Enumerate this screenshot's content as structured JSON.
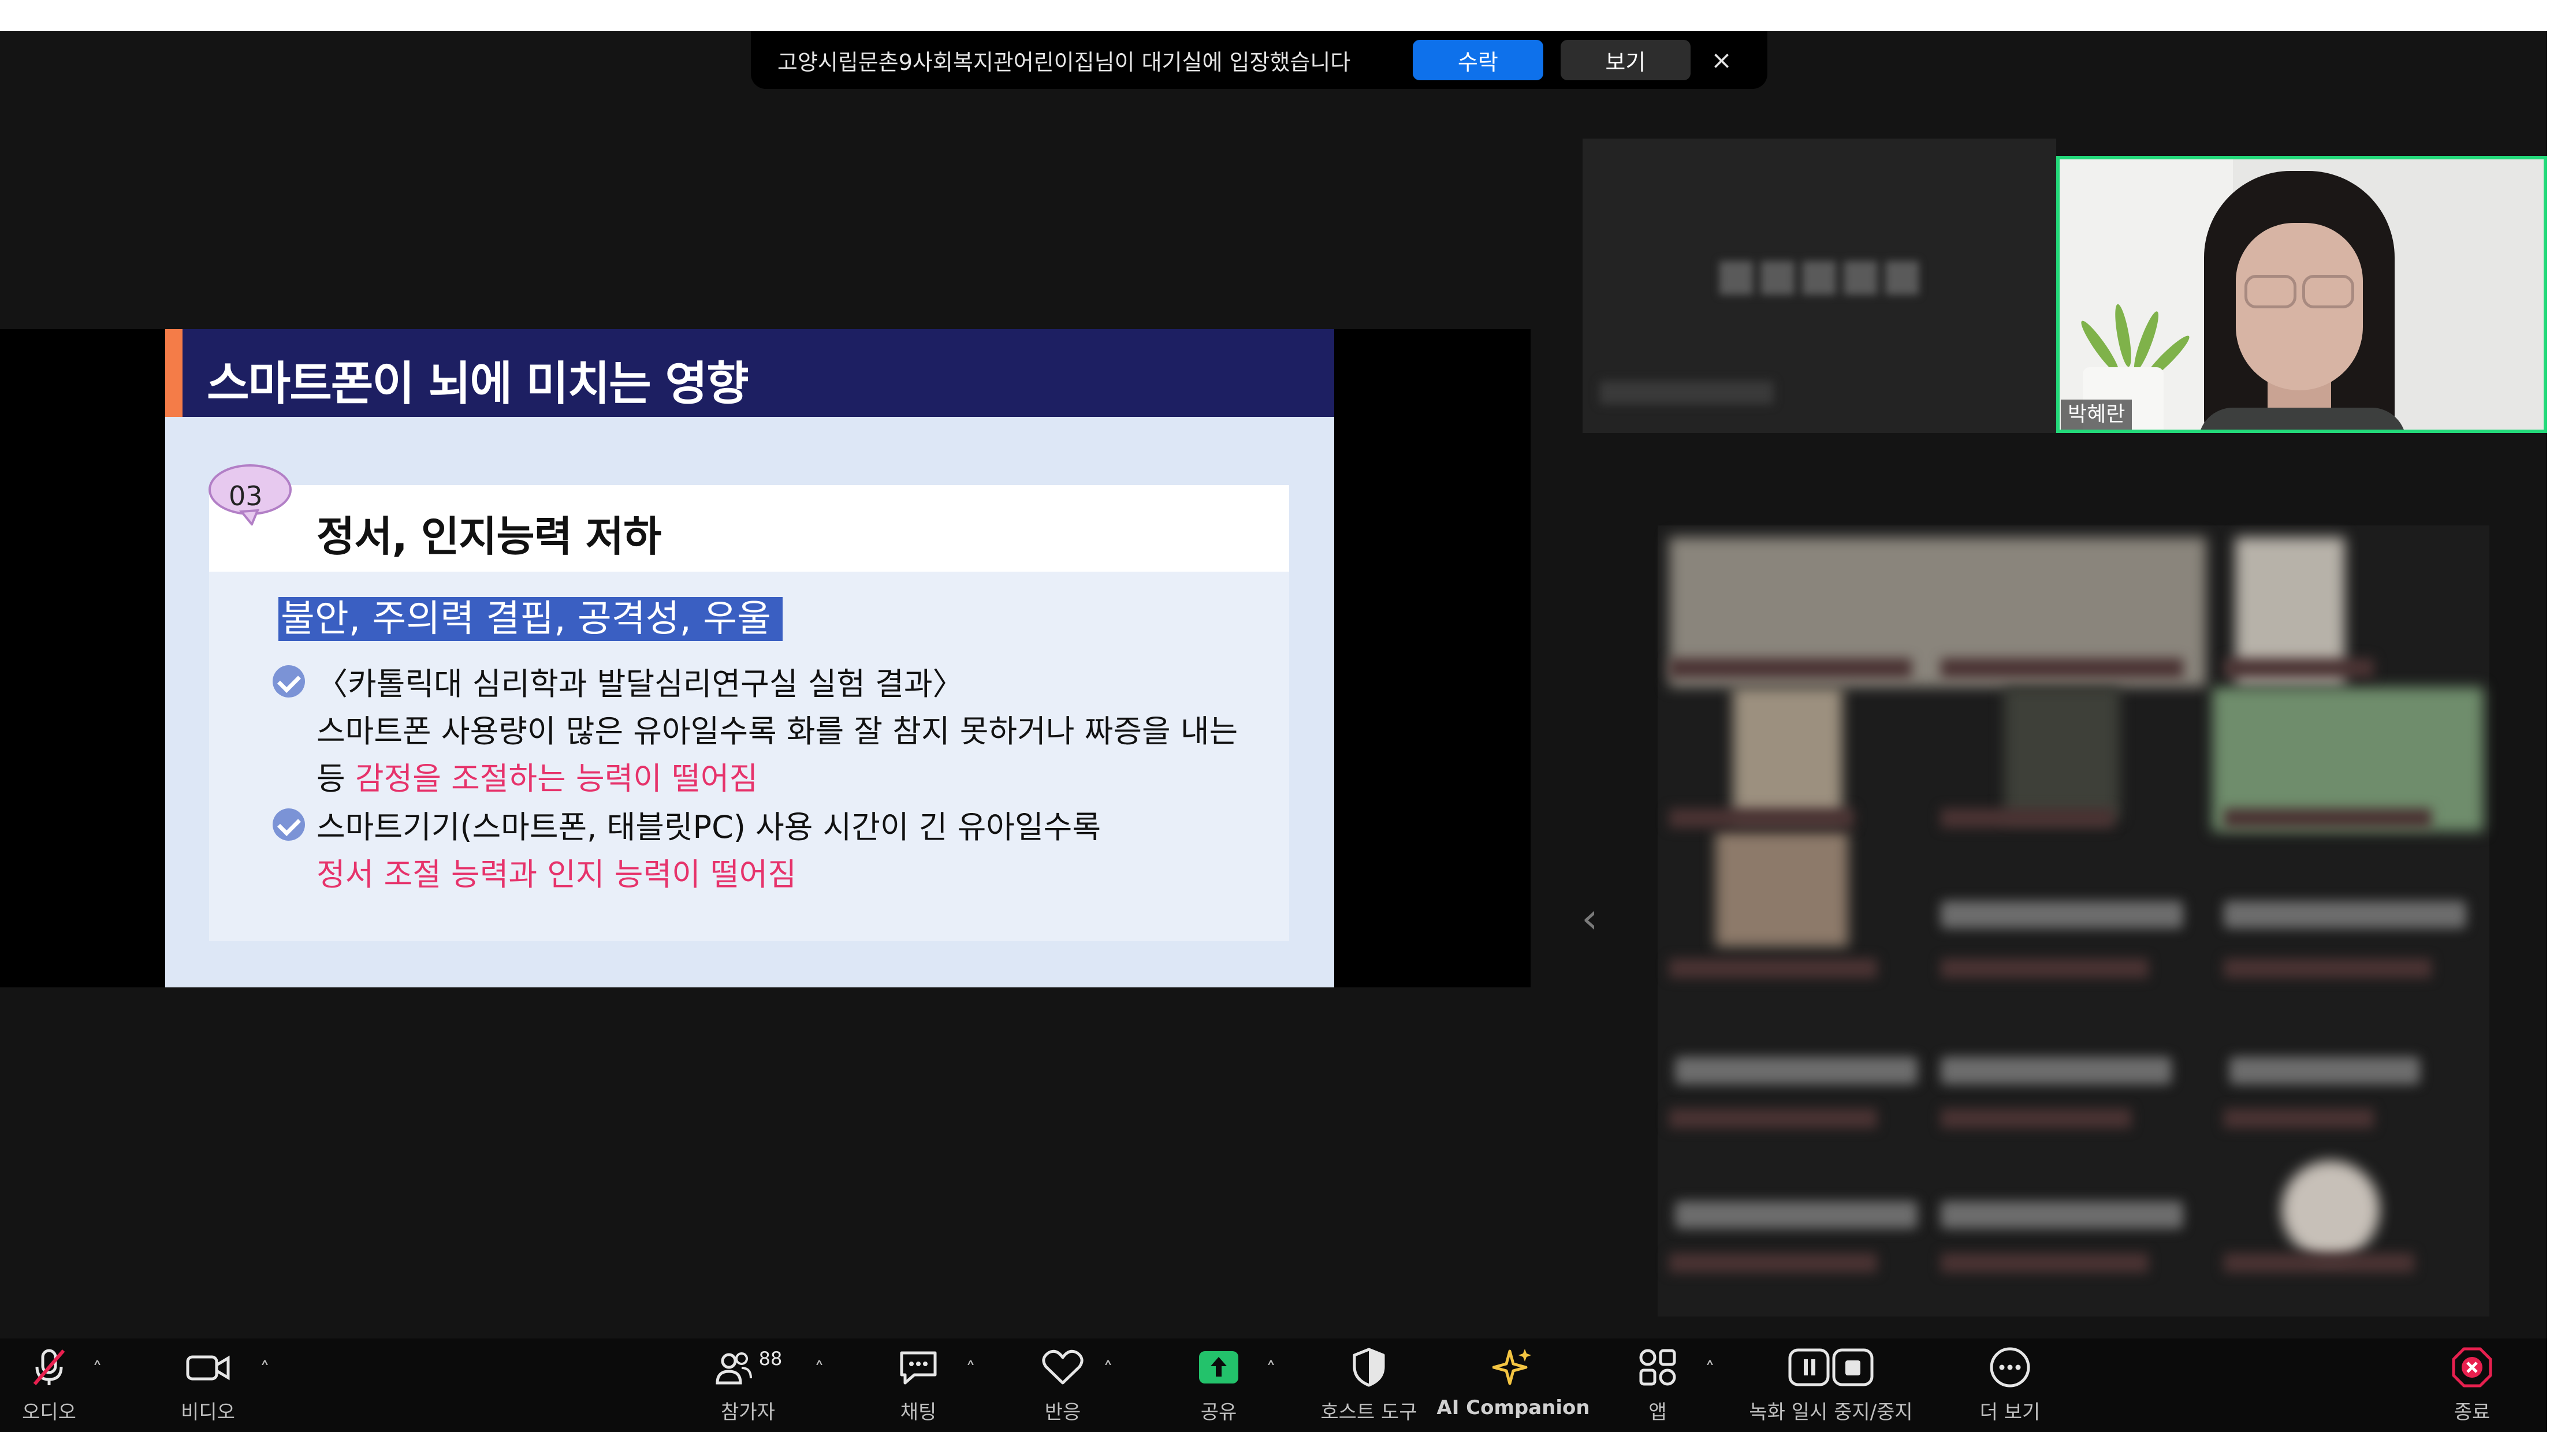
{
  "notification": {
    "message": "고양시립문촌9사회복지관어린이집님이 대기실에 입장했습니다",
    "admit_label": "수락",
    "view_label": "보기",
    "close_symbol": "×"
  },
  "slide": {
    "title": "스마트폰이 뇌에 미치는 영향",
    "badge_number": "03",
    "section_title": "정서, 인지능력 저하",
    "highlight": "불안, 주의력 결핍, 공격성, 우울",
    "bullet1_line1": "〈카톨릭대 심리학과 발달심리연구실 실험 결과〉",
    "bullet1_line2": "스마트폰 사용량이 많은 유아일수록 화를 잘 참지 못하거나 짜증을 내는",
    "bullet1_line3_prefix": "등 ",
    "bullet1_line3_emphasis": "감정을 조절하는 능력이 떨어짐",
    "bullet2_line1": "스마트기기(스마트폰, 태블릿PC) 사용 시간이 긴 유아일수록",
    "bullet2_line2_emphasis": "정서 조절 능력과 인지 능력이 떨어짐",
    "colors": {
      "header": "#1d1f62",
      "accent": "#f47c48",
      "emphasis": "#e6336b",
      "highlight": "#3a5fc2"
    }
  },
  "speaker": {
    "name": "박혜란",
    "border_color": "#23d97a"
  },
  "gallery": {
    "prev_icon": "chevron-left-icon"
  },
  "toolbar": {
    "audio": {
      "label": "오디오",
      "icon": "mic-muted-icon"
    },
    "video": {
      "label": "비디오",
      "icon": "video-camera-icon"
    },
    "participants": {
      "label": "참가자",
      "count": "88",
      "icon": "participants-icon"
    },
    "chat": {
      "label": "채팅",
      "icon": "chat-icon"
    },
    "reactions": {
      "label": "반응",
      "icon": "heart-icon"
    },
    "share": {
      "label": "공유",
      "icon": "share-screen-icon",
      "color": "#23c26b"
    },
    "host_tools": {
      "label": "호스트 도구",
      "icon": "shield-icon"
    },
    "ai_companion": {
      "label": "AI Companion",
      "icon": "sparkle-icon",
      "color": "#f4c542"
    },
    "apps": {
      "label": "앱",
      "icon": "apps-icon"
    },
    "recording": {
      "label": "녹화 일시 중지/중지",
      "icon": "pause-stop-icon"
    },
    "more": {
      "label": "더 보기",
      "icon": "more-icon"
    },
    "end": {
      "label": "종료",
      "icon": "end-icon",
      "color": "#e8204f"
    },
    "caret": "˄"
  }
}
